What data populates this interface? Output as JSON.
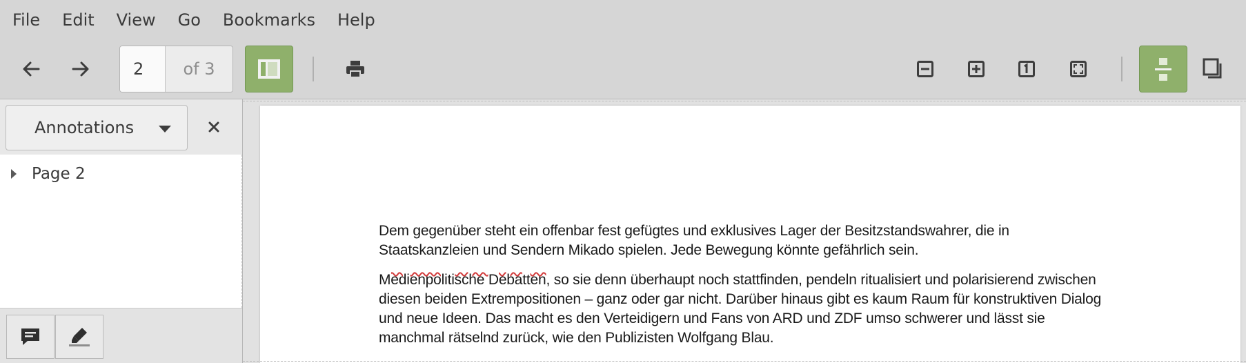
{
  "menu": {
    "items": [
      "File",
      "Edit",
      "View",
      "Go",
      "Bookmarks",
      "Help"
    ]
  },
  "toolbar": {
    "page_current": "2",
    "page_of": "of 3"
  },
  "sidebar": {
    "mode_label": "Annotations",
    "tree": [
      {
        "label": "Page 2"
      }
    ]
  },
  "document": {
    "paragraphs": [
      [
        "Dem gegenüber steht ein offenbar fest gefügtes und exklusives Lager der Besitzstandswahrer, die in",
        "Staatskanzleien und Sendern Mikado spielen. Jede Bewegung könnte gefährlich sein."
      ],
      [
        "Medienpolitische Debatten, so sie denn überhaupt noch stattfinden, pendeln ritualisiert und polarisierend zwischen",
        "diesen beiden Extrempositionen – ganz oder gar nicht. Darüber hinaus gibt es kaum Raum für konstruktiven Dialog",
        "und neue Ideen. Das macht es den Verteidigern und Fans von ARD und ZDF umso schwerer und lässt sie",
        "manchmal rätselnd zurück, wie den Publizisten Wolfgang Blau."
      ]
    ],
    "highlight_word": "Medienpolitische Debatten",
    "highlight_rest": ", so sie denn überhaupt noch stattfinden, pendeln ritualisiert und polarisierend zwischen"
  },
  "colors": {
    "accent_toggle": "#8fb06b",
    "window_bg": "#d6d6d6"
  }
}
